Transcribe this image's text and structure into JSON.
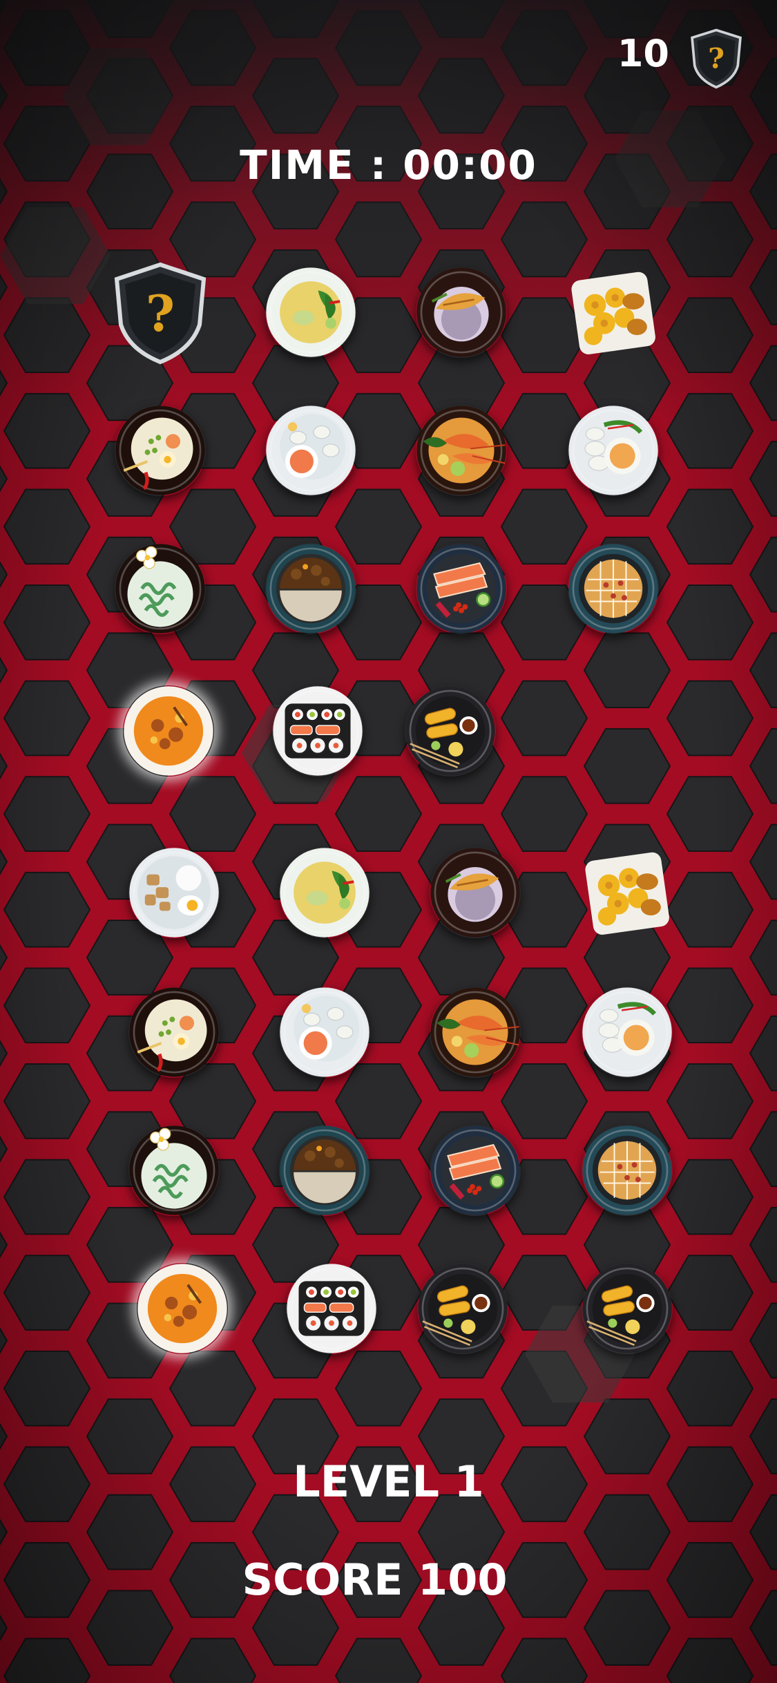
{
  "hud": {
    "hint_count": "10",
    "timer_text": "TIME : 00:00",
    "level_text": "LEVEL 1",
    "score_text": "SCORE 100"
  },
  "colors": {
    "background": "#1c1c1e",
    "hex_outline": "#d4102f",
    "text": "#ffffff"
  },
  "board": {
    "rows": [
      [
        "hint-shield",
        "green-curry",
        "grilled-fish-rice",
        "fried-chicken"
      ],
      [
        "noodle-soup",
        "dumplings-soup",
        "shrimp-platter",
        "dumpling-dip"
      ],
      [
        "green-noodles",
        "curry-rice",
        "salmon-sashimi",
        "okonomiyaki"
      ],
      [
        "orange-curry",
        "sushi-platter",
        "spring-rolls",
        null
      ],
      [
        "chicken-rice-egg",
        "green-curry",
        "grilled-fish-rice",
        "fried-chicken"
      ],
      [
        "noodle-soup",
        "dumplings-soup",
        "shrimp-platter",
        "dumpling-dip"
      ],
      [
        "green-noodles",
        "curry-rice",
        "salmon-sashimi",
        "okonomiyaki"
      ],
      [
        "orange-curry",
        "sushi-platter",
        "spring-rolls",
        "spring-rolls"
      ]
    ]
  }
}
